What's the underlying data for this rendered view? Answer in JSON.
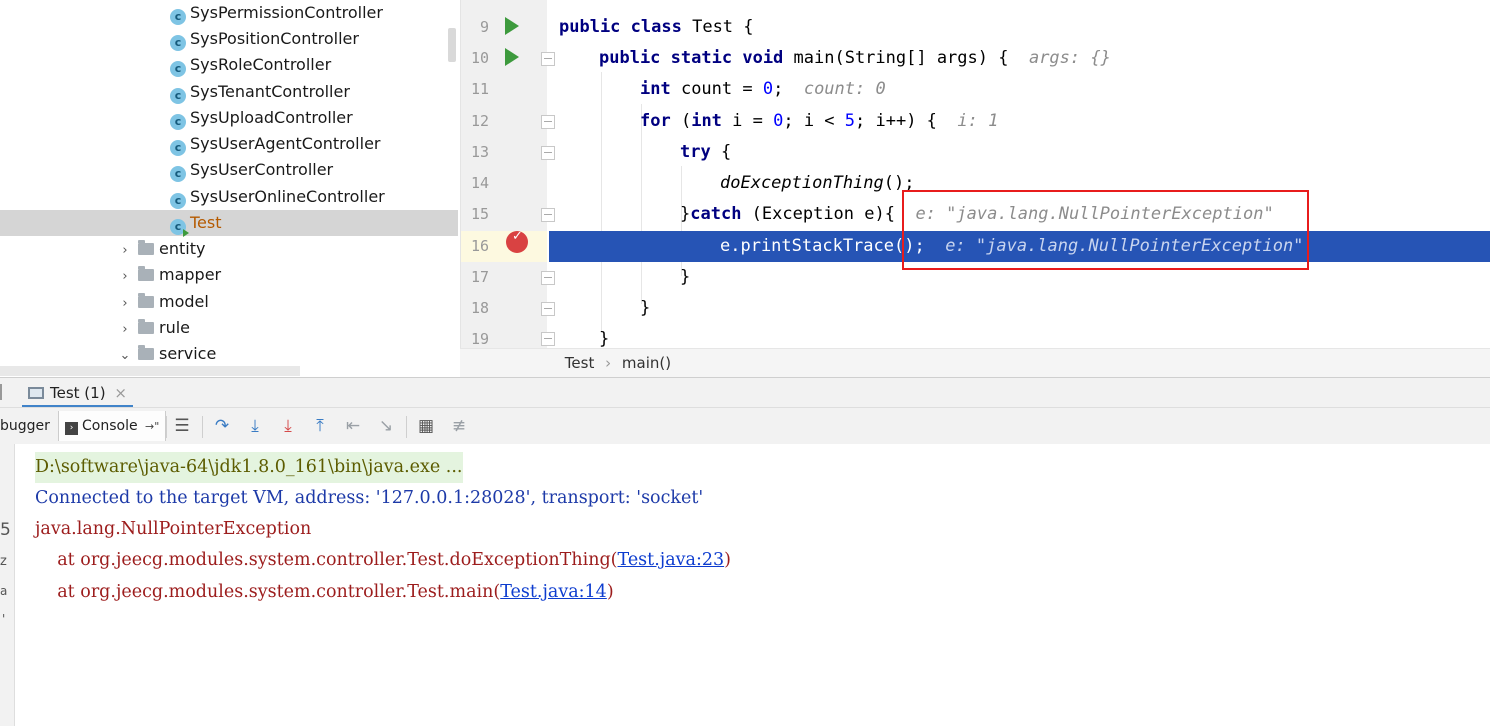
{
  "tree": {
    "classes": [
      "SysPermissionController",
      "SysPositionController",
      "SysRoleController",
      "SysTenantController",
      "SysUploadController",
      "SysUserAgentController",
      "SysUserController",
      "SysUserOnlineController"
    ],
    "selected_class": "Test",
    "packages": [
      {
        "label": "entity",
        "expanded": false
      },
      {
        "label": "mapper",
        "expanded": false
      },
      {
        "label": "model",
        "expanded": false
      },
      {
        "label": "rule",
        "expanded": false
      },
      {
        "label": "service",
        "expanded": true
      }
    ],
    "class_icon_letter": "c"
  },
  "editor": {
    "line_numbers": [
      "9",
      "10",
      "11",
      "12",
      "13",
      "14",
      "15",
      "16",
      "17",
      "18",
      "19"
    ],
    "code": {
      "l9": {
        "kw1": "public",
        "kw2": "class",
        "rest": " Test {"
      },
      "l10": {
        "kw1": "public",
        "kw2": "static",
        "kw3": "void",
        "rest": " main(String[] args) {",
        "hint": "args: {}"
      },
      "l11": {
        "kw": "int",
        "rest1": " count = ",
        "num": "0",
        "rest2": ";",
        "hint": "count: 0"
      },
      "l12": {
        "kw": "for",
        "p1": " (",
        "kw2": "int",
        "p2": " i = ",
        "n1": "0",
        "p3": "; i < ",
        "n2": "5",
        "p4": "; i++) {",
        "hint": "i: 1"
      },
      "l13": {
        "kw": "try",
        "rest": " {"
      },
      "l14": {
        "call": "doExceptionThing",
        "rest": "();"
      },
      "l15": {
        "p1": "}",
        "kw": "catch",
        "rest": " (Exception e){",
        "hint": "e: \"java.lang.NullPointerException\""
      },
      "l16": {
        "rest": "e.printStackTrace();",
        "hint": "e: \"java.lang.NullPointerException\""
      },
      "l17": {
        "rest": "}"
      },
      "l18": {
        "rest": "}"
      },
      "l19": {
        "rest": "}"
      }
    },
    "breakpoint_check": "✓"
  },
  "breadcrumb": {
    "class": "Test",
    "separator": "›",
    "method": "main()"
  },
  "debug": {
    "session_tab": "Test (1)",
    "session_close": "×",
    "debugger_tab": "bugger",
    "console_tab": "Console",
    "console_tab_suffix": "→\"",
    "left_markers": [
      "5",
      "z",
      "a",
      "'"
    ]
  },
  "console": {
    "cmd": "D:\\software\\java-64\\jdk1.8.0_161\\bin\\java.exe ...",
    "connected": "Connected to the target VM, address: '127.0.0.1:28028', transport: 'socket'",
    "exception": "java.lang.NullPointerException",
    "trace": [
      {
        "prefix": "    at org.jeecg.modules.system.controller.Test.doExceptionThing(",
        "link": "Test.java:23",
        "suffix": ")"
      },
      {
        "prefix": "    at org.jeecg.modules.system.controller.Test.main(",
        "link": "Test.java:14",
        "suffix": ")"
      }
    ]
  }
}
